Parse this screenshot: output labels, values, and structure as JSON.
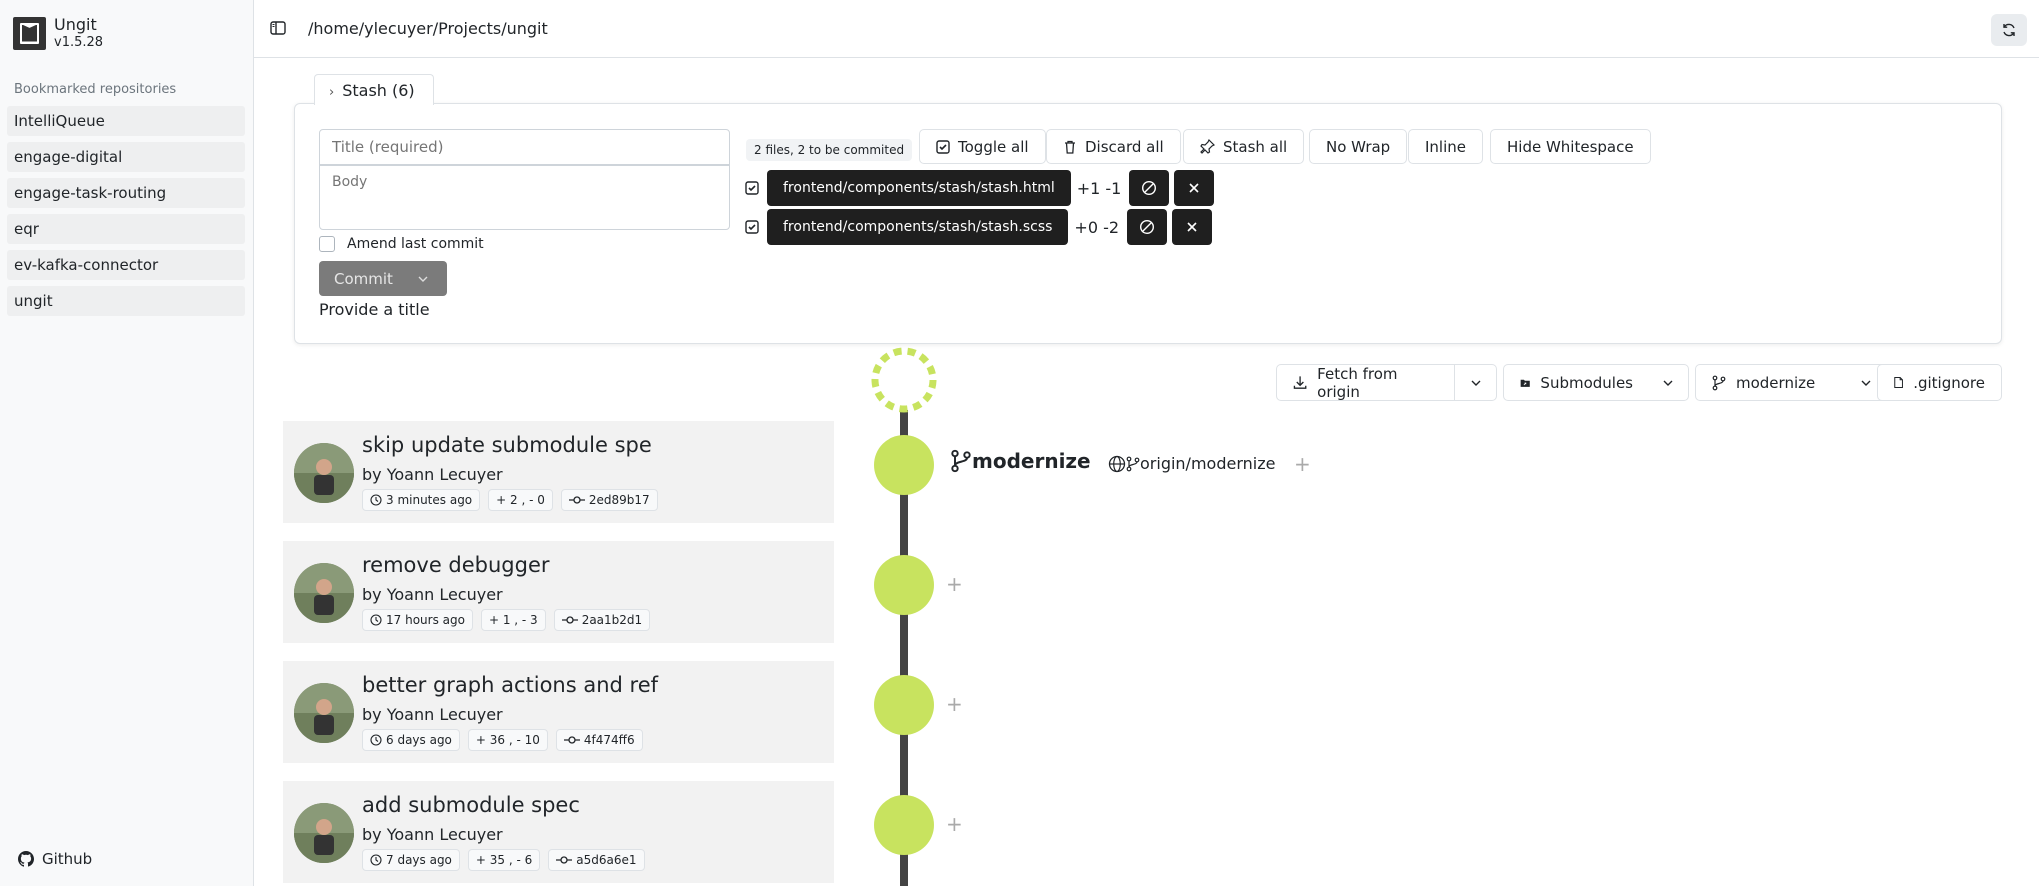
{
  "app": {
    "name": "Ungit",
    "version": "v1.5.28"
  },
  "sidebar": {
    "heading": "Bookmarked repositories",
    "items": [
      {
        "label": "IntelliQueue"
      },
      {
        "label": "engage-digital"
      },
      {
        "label": "engage-task-routing"
      },
      {
        "label": "eqr"
      },
      {
        "label": "ev-kafka-connector"
      },
      {
        "label": "ungit"
      }
    ],
    "github_label": "Github"
  },
  "header": {
    "path": "/home/ylecuyer/Projects/ungit"
  },
  "stash": {
    "label": "Stash (6)"
  },
  "staging": {
    "title_placeholder": "Title (required)",
    "body_placeholder": "Body",
    "amend_label": "Amend last commit",
    "commit_label": "Commit",
    "provide_title": "Provide a title",
    "files_count": "2 files, 2 to be commited",
    "buttons": {
      "toggle_all": "Toggle all",
      "discard_all": "Discard all",
      "stash_all": "Stash all",
      "no_wrap": "No Wrap",
      "inline": "Inline",
      "hide_whitespace": "Hide Whitespace"
    },
    "files": [
      {
        "name": "frontend/components/stash/stash.html",
        "diff": "+1 -1"
      },
      {
        "name": "frontend/components/stash/stash.scss",
        "diff": "+0 -2"
      }
    ]
  },
  "toolbar": {
    "fetch": "Fetch from origin",
    "submodules": "Submodules",
    "branch": "modernize",
    "gitignore": ".gitignore"
  },
  "refs": {
    "local": "modernize",
    "remote": "origin/modernize"
  },
  "commits": [
    {
      "title": "skip update submodule spe",
      "author": "by Yoann Lecuyer",
      "time": "3 minutes ago",
      "stats": "+ 2 , - 0",
      "sha": "2ed89b17"
    },
    {
      "title": "remove debugger",
      "author": "by Yoann Lecuyer",
      "time": "17 hours ago",
      "stats": "+ 1 , - 3",
      "sha": "2aa1b2d1"
    },
    {
      "title": "better graph actions and ref",
      "author": "by Yoann Lecuyer",
      "time": "6 days ago",
      "stats": "+ 36 , - 10",
      "sha": "4f474ff6"
    },
    {
      "title": "add submodule spec",
      "author": "by Yoann Lecuyer",
      "time": "7 days ago",
      "stats": "+ 35 , - 6",
      "sha": "a5d6a6e1"
    }
  ],
  "colors": {
    "node": "#c8e35f",
    "graph_line": "#444444",
    "file_chip": "#1f1f1f"
  }
}
